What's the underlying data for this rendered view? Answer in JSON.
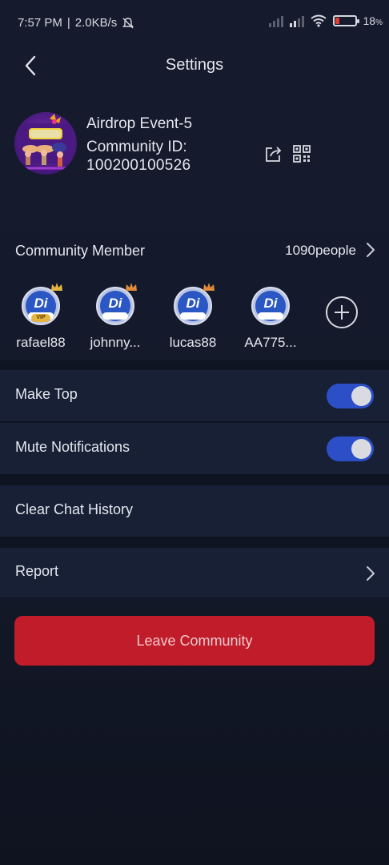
{
  "status_bar": {
    "time": "7:57 PM",
    "separator": "|",
    "network_speed": "2.0KB/s",
    "icons": [
      "mute-bell-icon",
      "signal-icon",
      "signal-icon",
      "wifi-icon",
      "battery-icon"
    ],
    "battery_percent": "18",
    "battery_level": 0.18
  },
  "header": {
    "title": "Settings",
    "back_icon": "chevron-left-icon"
  },
  "community": {
    "name": "Airdrop Event-5",
    "id_label": "Community ID:",
    "id": "100200100526",
    "actions": [
      "share-icon",
      "qr-code-icon"
    ]
  },
  "members": {
    "label": "Community Member",
    "count": "1090people",
    "list": [
      {
        "name": "rafael88",
        "vip": true
      },
      {
        "name": "johnny...",
        "vip": false
      },
      {
        "name": "lucas88",
        "vip": false
      },
      {
        "name": "AA775...",
        "vip": false
      }
    ],
    "add_icon": "plus-circle-icon"
  },
  "settings": {
    "make_top": {
      "label": "Make Top",
      "enabled": true
    },
    "mute_notifications": {
      "label": "Mute Notifications",
      "enabled": true
    },
    "clear_history": {
      "label": "Clear Chat History"
    },
    "report": {
      "label": "Report"
    }
  },
  "leave_button": {
    "label": "Leave Community"
  },
  "colors": {
    "background": "#151b2c",
    "row": "#172035",
    "toggle_on": "#2c4fc8",
    "leave": "#c01c2a"
  }
}
